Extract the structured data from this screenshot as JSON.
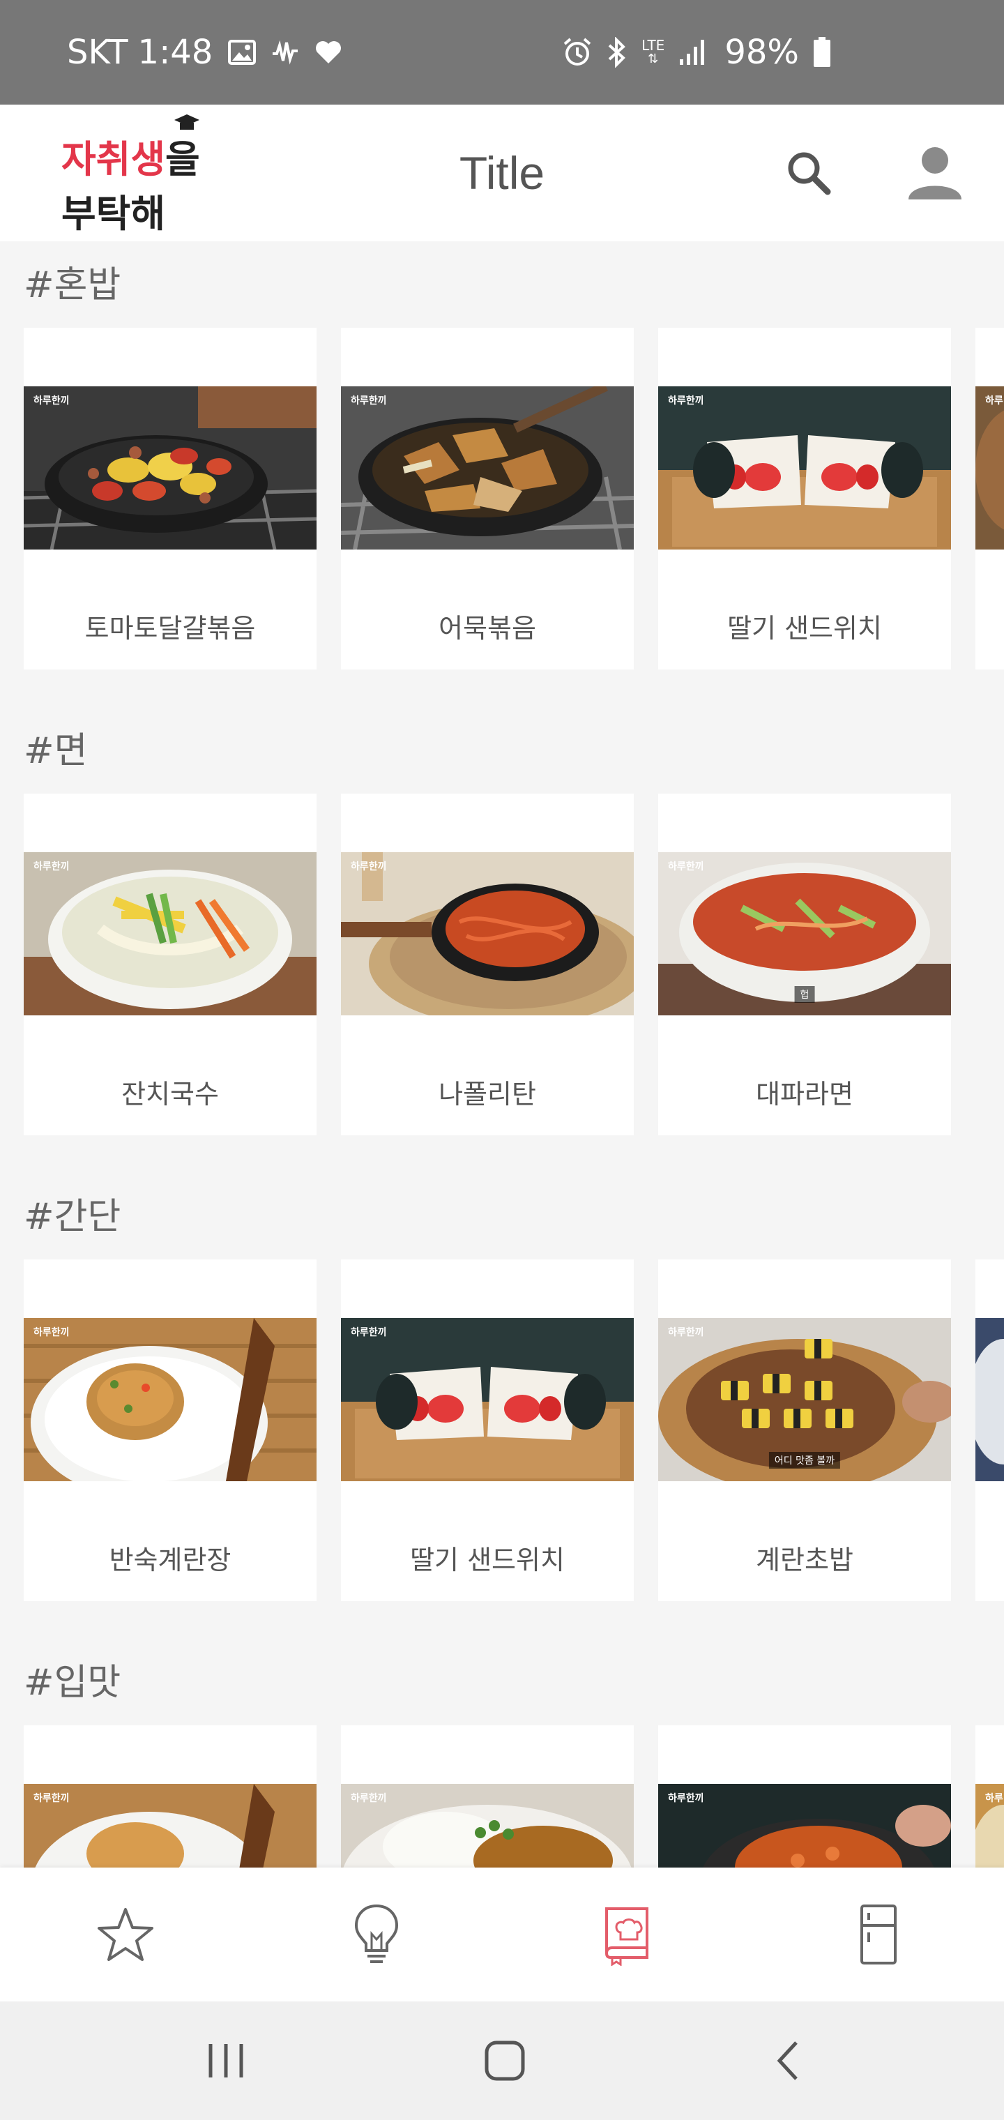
{
  "status_bar": {
    "carrier": "SKT",
    "time": "1:48",
    "network": "LTE",
    "battery": "98%",
    "left_icons": [
      "image-icon",
      "signal-wave-icon",
      "heart-icon"
    ],
    "right_icons": [
      "alarm-icon",
      "bluetooth-icon",
      "lte-icon",
      "signal-bars-icon",
      "battery-icon"
    ]
  },
  "header": {
    "logo_line1_red": "자취생",
    "logo_line1_dark": "을",
    "logo_line2": "부탁해",
    "title": "Title",
    "search_icon": "search-icon",
    "account_icon": "account-icon"
  },
  "sections": [
    {
      "title": "#혼밥",
      "cards": [
        {
          "label": "토마토달걀볶음",
          "watermark": "하루한끼",
          "caption": ""
        },
        {
          "label": "어묵볶음",
          "watermark": "하루한끼",
          "caption": ""
        },
        {
          "label": "딸기 샌드위치",
          "watermark": "하루한끼",
          "caption": ""
        },
        {
          "label": "",
          "watermark": "하루",
          "caption": ""
        }
      ]
    },
    {
      "title": "#면",
      "cards": [
        {
          "label": "잔치국수",
          "watermark": "하루한끼",
          "caption": ""
        },
        {
          "label": "나폴리탄",
          "watermark": "하루한끼",
          "caption": ""
        },
        {
          "label": "대파라면",
          "watermark": "하루한끼",
          "caption": "헙"
        }
      ]
    },
    {
      "title": "#간단",
      "cards": [
        {
          "label": "반숙계란장",
          "watermark": "하루한끼",
          "caption": ""
        },
        {
          "label": "딸기 샌드위치",
          "watermark": "하루한끼",
          "caption": ""
        },
        {
          "label": "계란초밥",
          "watermark": "하루한끼",
          "caption": "어디 맛좀 볼까"
        },
        {
          "label": "",
          "watermark": "",
          "caption": ""
        }
      ]
    },
    {
      "title": "#입맛",
      "cards": [
        {
          "label": "",
          "watermark": "하루한끼",
          "caption": ""
        },
        {
          "label": "",
          "watermark": "하루한끼",
          "caption": ""
        },
        {
          "label": "",
          "watermark": "하루한끼",
          "caption": ""
        },
        {
          "label": "",
          "watermark": "하루",
          "caption": ""
        }
      ]
    }
  ],
  "bottom_nav": [
    {
      "icon": "star-icon",
      "active": false
    },
    {
      "icon": "lightbulb-icon",
      "active": false
    },
    {
      "icon": "recipe-book-icon",
      "active": true
    },
    {
      "icon": "refrigerator-icon",
      "active": false
    }
  ],
  "colors": {
    "accent": "#e35d6a",
    "status_bar": "#777777",
    "background": "#f5f5f5",
    "nav_icon": "#666666"
  }
}
